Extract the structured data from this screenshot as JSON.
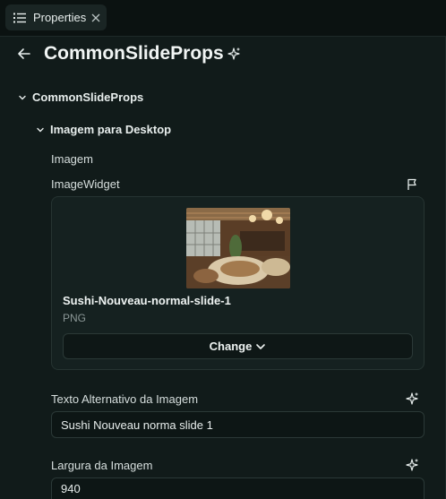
{
  "tab": {
    "title": "Properties",
    "icon": "list-icon",
    "close_icon": "close-icon"
  },
  "header": {
    "title": "CommonSlideProps",
    "back_icon": "arrow-left-icon",
    "ai_icon": "sparkle-icon"
  },
  "tree": {
    "root_label": "CommonSlideProps",
    "section_label": "Imagem para Desktop"
  },
  "image_field": {
    "label": "Imagem",
    "widget_label": "ImageWidget",
    "file_name": "Sushi-Nouveau-normal-slide-1",
    "file_type": "PNG",
    "change_label": "Change"
  },
  "alt_text": {
    "label": "Texto Alternativo da Imagem",
    "value": "Sushi Nouveau norma slide 1"
  },
  "width": {
    "label": "Largura da Imagem",
    "value": "940"
  },
  "colors": {
    "background": "#111b1a",
    "tabbar": "#0b1211",
    "border": "#2b3937",
    "text": "#e8eeed"
  }
}
